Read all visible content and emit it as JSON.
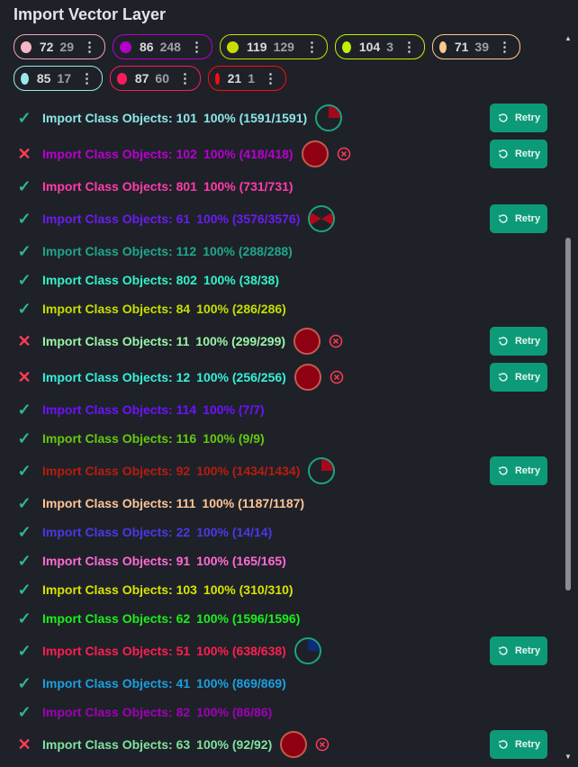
{
  "title": "Import Vector Layer",
  "chips": [
    {
      "color": "#f6b6c4",
      "border": "#f0a3b5",
      "a": "72",
      "b": "29"
    },
    {
      "color": "#b400c8",
      "border": "#b400c8",
      "a": "86",
      "b": "248"
    },
    {
      "color": "#c9de00",
      "border": "#c9de00",
      "a": "119",
      "b": "129"
    },
    {
      "color": "#c3f000",
      "border": "#c3f000",
      "a": "104",
      "b": "3"
    },
    {
      "color": "#ffc98a",
      "border": "#ffc98a",
      "a": "71",
      "b": "39"
    },
    {
      "color": "#9be8e9",
      "border": "#9be8e9",
      "a": "85",
      "b": "17"
    },
    {
      "color": "#ff1a5a",
      "border": "#ff1a5a",
      "a": "87",
      "b": "60"
    },
    {
      "color": "#ff0a0a",
      "border": "#ff0a0a",
      "a": "21",
      "b": "1"
    }
  ],
  "retry_label": "Retry",
  "rows": [
    {
      "status": "ok",
      "name": "Import Class Objects: 101",
      "progress": "100% (1591/1591)",
      "color": "#8ee6e6",
      "pie": 0.25,
      "pieFill": "#a6081b",
      "retry": true,
      "tall": true
    },
    {
      "status": "fail",
      "name": "Import Class Objects: 102",
      "progress": "100% (418/418)",
      "color": "#b700d0",
      "pie": 1,
      "pieFill": "#8e0012",
      "cancel": true,
      "retry": true,
      "tall": true
    },
    {
      "status": "ok",
      "name": "Import Class Objects: 801",
      "progress": "100% (731/731)",
      "color": "#ff3caa",
      "tall": false
    },
    {
      "status": "ok",
      "name": "Import Class Objects: 61",
      "progress": "100% (3576/3576)",
      "color": "#6a1df0",
      "pie": 0.5,
      "pieFill": "#b3081b",
      "retry": true,
      "tall": true
    },
    {
      "status": "ok",
      "name": "Import Class Objects: 112",
      "progress": "100% (288/288)",
      "color": "#1fa78a"
    },
    {
      "status": "ok",
      "name": "Import Class Objects: 802",
      "progress": "100% (38/38)",
      "color": "#33f2c6"
    },
    {
      "status": "ok",
      "name": "Import Class Objects: 84",
      "progress": "100% (286/286)",
      "color": "#c6df00"
    },
    {
      "status": "fail",
      "name": "Import Class Objects: 11",
      "progress": "100% (299/299)",
      "color": "#98f5a8",
      "pie": 1,
      "pieFill": "#8e0012",
      "cancel": true,
      "retry": true,
      "tall": true
    },
    {
      "status": "fail",
      "name": "Import Class Objects: 12",
      "progress": "100% (256/256)",
      "color": "#35f0dc",
      "pie": 1,
      "pieFill": "#8e0012",
      "cancel": true,
      "retry": true,
      "tall": true
    },
    {
      "status": "ok",
      "name": "Import Class Objects: 114",
      "progress": "100% (7/7)",
      "color": "#6d12ff"
    },
    {
      "status": "ok",
      "name": "Import Class Objects: 116",
      "progress": "100% (9/9)",
      "color": "#65c90e"
    },
    {
      "status": "ok",
      "name": "Import Class Objects: 92",
      "progress": "100% (1434/1434)",
      "color": "#b81c10",
      "pie": 0.25,
      "pieFill": "#a6081b",
      "retry": true,
      "tall": true
    },
    {
      "status": "ok",
      "name": "Import Class Objects: 111",
      "progress": "100% (1187/1187)",
      "color": "#ffc595"
    },
    {
      "status": "ok",
      "name": "Import Class Objects: 22",
      "progress": "100% (14/14)",
      "color": "#4a38e6"
    },
    {
      "status": "ok",
      "name": "Import Class Objects: 91",
      "progress": "100% (165/165)",
      "color": "#ff6bd6"
    },
    {
      "status": "ok",
      "name": "Import Class Objects: 103",
      "progress": "100% (310/310)",
      "color": "#d6e400"
    },
    {
      "status": "ok",
      "name": "Import Class Objects: 62",
      "progress": "100% (1596/1596)",
      "color": "#19f01b"
    },
    {
      "status": "ok",
      "name": "Import Class Objects: 51",
      "progress": "100% (638/638)",
      "color": "#ff1e50",
      "pie": 0.25,
      "pieFill": "#0e2a7a",
      "retry": true,
      "tall": true
    },
    {
      "status": "ok",
      "name": "Import Class Objects: 41",
      "progress": "100% (869/869)",
      "color": "#1aa0e0"
    },
    {
      "status": "ok",
      "name": "Import Class Objects: 82",
      "progress": "100% (86/86)",
      "color": "#a000b8"
    },
    {
      "status": "fail",
      "name": "Import Class Objects: 63",
      "progress": "100% (92/92)",
      "color": "#7fe3a0",
      "pie": 1,
      "pieFill": "#8e0012",
      "cancel": true,
      "retry": true,
      "tall": true
    }
  ]
}
